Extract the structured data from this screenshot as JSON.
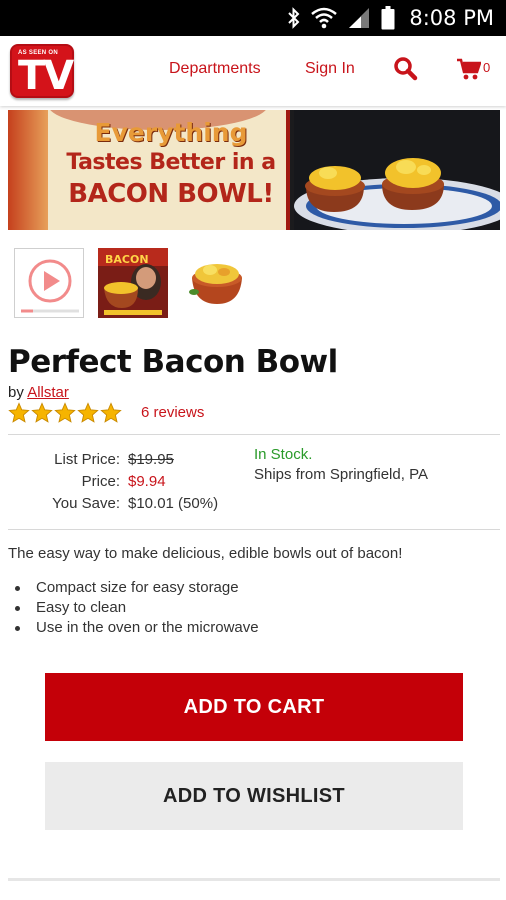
{
  "status_bar": {
    "time": "8:08 PM",
    "icons": [
      "bluetooth-icon",
      "wifi-icon",
      "signal-icon",
      "battery-icon"
    ]
  },
  "header": {
    "logo_small_text": "AS SEEN ON",
    "logo_text": "TV",
    "nav": {
      "departments": "Departments",
      "sign_in": "Sign In"
    },
    "cart_count": "0",
    "brand_color": "#c8141b"
  },
  "banner": {
    "line1": "Everything",
    "line2": "Tastes Better in a",
    "line3": "BACON BOWL!"
  },
  "thumbnails": [
    {
      "type": "video",
      "icon": "play-icon"
    },
    {
      "type": "image",
      "label": "BACON"
    },
    {
      "type": "image",
      "label": ""
    }
  ],
  "product": {
    "title": "Perfect Bacon Bowl",
    "by_label": "by",
    "brand": "Allstar",
    "rating": 5,
    "reviews": "6 reviews",
    "pricing": {
      "list_label": "List Price:",
      "list_value": "$19.95",
      "price_label": "Price:",
      "price_value": "$9.94",
      "save_label": "You Save:",
      "save_value": "$10.01 (50%)"
    },
    "stock": "In Stock.",
    "ships_from": "Ships from Springfield, PA",
    "description": "The easy way to make delicious, edible bowls out of bacon!",
    "features": [
      "Compact size for easy storage",
      "Easy to clean",
      "Use in the oven or the microwave"
    ]
  },
  "actions": {
    "add_to_cart": "ADD TO CART",
    "add_to_wishlist": "ADD TO WISHLIST",
    "cart_color": "#c40008",
    "wishlist_color": "#ebebeb"
  }
}
